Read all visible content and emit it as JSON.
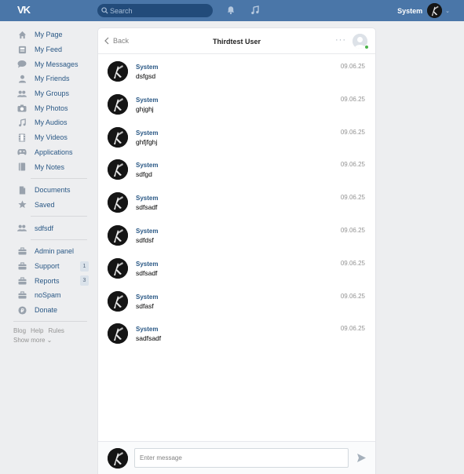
{
  "topbar": {
    "logo": "VK",
    "search_placeholder": "Search",
    "user_name": "System",
    "caret": "⌄"
  },
  "sidebar": {
    "items": [
      {
        "label": "My Page",
        "icon": "home-icon"
      },
      {
        "label": "My Feed",
        "icon": "news-icon"
      },
      {
        "label": "My Messages",
        "icon": "messages-icon"
      },
      {
        "label": "My Friends",
        "icon": "user-icon"
      },
      {
        "label": "My Groups",
        "icon": "users-icon"
      },
      {
        "label": "My Photos",
        "icon": "camera-icon"
      },
      {
        "label": "My Audios",
        "icon": "music-note-icon"
      },
      {
        "label": "My Videos",
        "icon": "film-icon"
      },
      {
        "label": "Applications",
        "icon": "gamepad-icon"
      },
      {
        "label": "My Notes",
        "icon": "notes-icon"
      }
    ],
    "items2": [
      {
        "label": "Documents",
        "icon": "document-icon"
      },
      {
        "label": "Saved",
        "icon": "star-icon"
      }
    ],
    "items3": [
      {
        "label": "sdfsdf",
        "icon": "users-icon"
      }
    ],
    "items4": [
      {
        "label": "Admin panel",
        "icon": "briefcase-icon"
      },
      {
        "label": "Support",
        "icon": "briefcase-icon",
        "badge": "1"
      },
      {
        "label": "Reports",
        "icon": "briefcase-icon",
        "badge": "3"
      },
      {
        "label": "noSpam",
        "icon": "briefcase-icon"
      },
      {
        "label": "Donate",
        "icon": "coin-icon"
      }
    ],
    "footer": {
      "links": [
        "Blog",
        "Help",
        "Rules"
      ],
      "show_more": "Show more ⌄"
    }
  },
  "chat": {
    "back_label": "Back",
    "title": "Thirdtest User",
    "more": "···",
    "messages": [
      {
        "author": "System",
        "text": "dsfgsd",
        "time": "09.06.25"
      },
      {
        "author": "System",
        "text": "ghjghj",
        "time": "09.06.25"
      },
      {
        "author": "System",
        "text": "ghfjfghj",
        "time": "09.06.25"
      },
      {
        "author": "System",
        "text": "sdfgd",
        "time": "09.06.25"
      },
      {
        "author": "System",
        "text": "sdfsadf",
        "time": "09.06.25"
      },
      {
        "author": "System",
        "text": "sdfdsf",
        "time": "09.06.25"
      },
      {
        "author": "System",
        "text": "sdfsadf",
        "time": "09.06.25"
      },
      {
        "author": "System",
        "text": "sdfasf",
        "time": "09.06.25"
      },
      {
        "author": "System",
        "text": "sadfsadf",
        "time": "09.06.25"
      }
    ],
    "composer_placeholder": "Enter message"
  },
  "colors": {
    "header_bg": "#4a76a8",
    "link": "#2a5885",
    "page_bg": "#edeef0",
    "online": "#4bb34b"
  }
}
